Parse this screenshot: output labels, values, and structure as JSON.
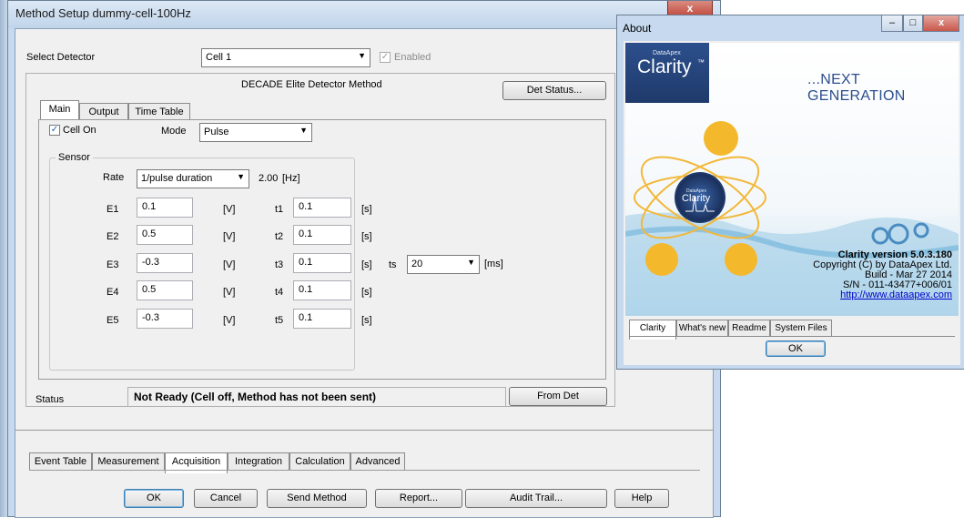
{
  "main_window": {
    "title": "Method Setup dummy-cell-100Hz",
    "close_glyph": "x",
    "select_detector_label": "Select Detector",
    "detector_value": "Cell 1",
    "enabled_label": "Enabled",
    "method_title": "DECADE Elite Detector Method",
    "det_status_button": "Det Status...",
    "inner_tabs": [
      "Main",
      "Output",
      "Time Table"
    ],
    "cell_on_label": "Cell On",
    "mode_label": "Mode",
    "mode_value": "Pulse",
    "sensor_label": "Sensor",
    "rate_label": "Rate",
    "rate_value": "1/pulse duration",
    "rate_display": "2.00",
    "rate_unit": "[Hz]",
    "e_rows": [
      {
        "label": "E1",
        "value": "0.1",
        "unit": "[V]"
      },
      {
        "label": "E2",
        "value": "0.5",
        "unit": "[V]"
      },
      {
        "label": "E3",
        "value": "-0.3",
        "unit": "[V]"
      },
      {
        "label": "E4",
        "value": "0.5",
        "unit": "[V]"
      },
      {
        "label": "E5",
        "value": "-0.3",
        "unit": "[V]"
      }
    ],
    "t_rows": [
      {
        "label": "t1",
        "value": "0.1",
        "unit": "[s]"
      },
      {
        "label": "t2",
        "value": "0.1",
        "unit": "[s]"
      },
      {
        "label": "t3",
        "value": "0.1",
        "unit": "[s]"
      },
      {
        "label": "t4",
        "value": "0.1",
        "unit": "[s]"
      },
      {
        "label": "t5",
        "value": "0.1",
        "unit": "[s]"
      }
    ],
    "ts_label": "ts",
    "ts_value": "20",
    "ts_unit": "[ms]",
    "status_label": "Status",
    "status_text": "Not Ready (Cell off, Method has not been sent)",
    "from_det_button": "From Det",
    "bottom_tabs": [
      "Event Table",
      "Measurement",
      "Acquisition",
      "Integration",
      "Calculation",
      "Advanced"
    ],
    "buttons": {
      "ok": "OK",
      "cancel": "Cancel",
      "send_method": "Send Method",
      "report": "Report...",
      "audit_trail": "Audit Trail...",
      "help": "Help"
    }
  },
  "about_window": {
    "title": "About",
    "brand_small": "DataApex",
    "brand": "Clarity",
    "tm": "™",
    "tagline": "...NEXT GENERATION",
    "emblem_small": "DataApex",
    "emblem_brand": "Clarity",
    "version": "Clarity version 5.0.3.180",
    "copyright": "Copyright (C) by DataApex Ltd.",
    "build": "Build - Mar 27 2014",
    "serial": "S/N - 011-43477+006/01",
    "link": "http://www.dataapex.com",
    "tabs": [
      "Clarity",
      "What's new",
      "Readme",
      "System Files"
    ],
    "ok_button": "OK"
  },
  "colors": {
    "title_blue": "#c6d9ee",
    "brand_navy": "#1f3a6b",
    "link_blue": "#0000cc",
    "close_red": "#c0463a"
  }
}
